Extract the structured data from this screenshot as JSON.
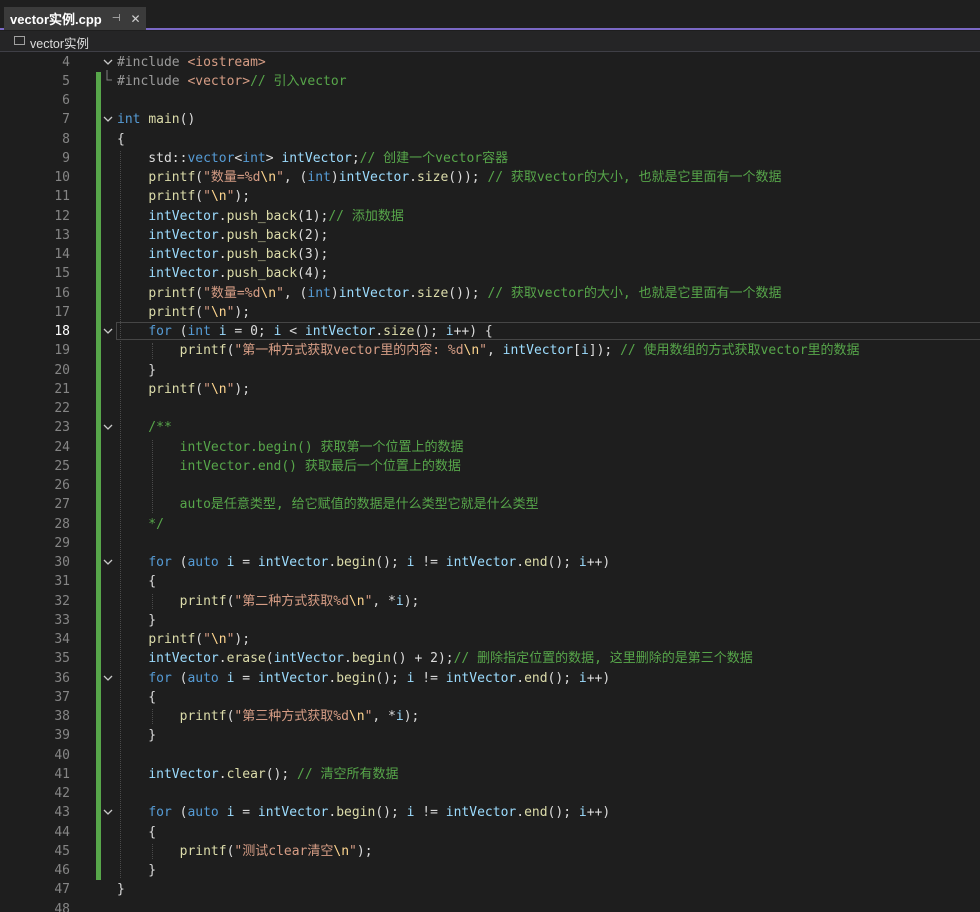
{
  "tab": {
    "title": "vector实例.cpp",
    "pin_glyph": "⊣",
    "close_glyph": "✕"
  },
  "navigation": {
    "file_label": "vector实例"
  },
  "editor": {
    "current_line": 18,
    "lines": [
      {
        "num": "4",
        "fold": "open",
        "tokens": [
          [
            "pp",
            "#include "
          ],
          [
            "str",
            "<iostream>"
          ]
        ]
      },
      {
        "num": "5",
        "fold": "end",
        "tokens": [
          [
            "pp",
            "#include "
          ],
          [
            "str",
            "<vector>"
          ],
          [
            "cm",
            "// 引入vector"
          ]
        ]
      },
      {
        "num": "6",
        "fold": "",
        "tokens": []
      },
      {
        "num": "7",
        "fold": "open",
        "tokens": [
          [
            "kw",
            "int"
          ],
          [
            "plain",
            " "
          ],
          [
            "fn",
            "main"
          ],
          [
            "plain",
            "()"
          ]
        ]
      },
      {
        "num": "8",
        "fold": "",
        "tokens": [
          [
            "plain",
            "{"
          ]
        ]
      },
      {
        "num": "9",
        "fold": "",
        "tokens": [
          [
            "plain",
            "    std::"
          ],
          [
            "kw",
            "vector"
          ],
          [
            "plain",
            "<"
          ],
          [
            "kw",
            "int"
          ],
          [
            "plain",
            "> "
          ],
          [
            "var",
            "intVector"
          ],
          [
            "plain",
            ";"
          ],
          [
            "cm",
            "// 创建一个vector容器"
          ]
        ]
      },
      {
        "num": "10",
        "fold": "",
        "tokens": [
          [
            "plain",
            "    "
          ],
          [
            "fn",
            "printf"
          ],
          [
            "plain",
            "("
          ],
          [
            "str",
            "\"数量=%d"
          ],
          [
            "esc",
            "\\n"
          ],
          [
            "str",
            "\""
          ],
          [
            "plain",
            ", ("
          ],
          [
            "kw",
            "int"
          ],
          [
            "plain",
            ")"
          ],
          [
            "var",
            "intVector"
          ],
          [
            "plain",
            "."
          ],
          [
            "fn",
            "size"
          ],
          [
            "plain",
            "()); "
          ],
          [
            "cm",
            "// 获取vector的大小, 也就是它里面有一个数据"
          ]
        ]
      },
      {
        "num": "11",
        "fold": "",
        "tokens": [
          [
            "plain",
            "    "
          ],
          [
            "fn",
            "printf"
          ],
          [
            "plain",
            "("
          ],
          [
            "str",
            "\""
          ],
          [
            "esc",
            "\\n"
          ],
          [
            "str",
            "\""
          ],
          [
            "plain",
            ");"
          ]
        ]
      },
      {
        "num": "12",
        "fold": "",
        "tokens": [
          [
            "plain",
            "    "
          ],
          [
            "var",
            "intVector"
          ],
          [
            "plain",
            "."
          ],
          [
            "fn",
            "push_back"
          ],
          [
            "plain",
            "(1);"
          ],
          [
            "cm",
            "// 添加数据"
          ]
        ]
      },
      {
        "num": "13",
        "fold": "",
        "tokens": [
          [
            "plain",
            "    "
          ],
          [
            "var",
            "intVector"
          ],
          [
            "plain",
            "."
          ],
          [
            "fn",
            "push_back"
          ],
          [
            "plain",
            "(2);"
          ]
        ]
      },
      {
        "num": "14",
        "fold": "",
        "tokens": [
          [
            "plain",
            "    "
          ],
          [
            "var",
            "intVector"
          ],
          [
            "plain",
            "."
          ],
          [
            "fn",
            "push_back"
          ],
          [
            "plain",
            "(3);"
          ]
        ]
      },
      {
        "num": "15",
        "fold": "",
        "tokens": [
          [
            "plain",
            "    "
          ],
          [
            "var",
            "intVector"
          ],
          [
            "plain",
            "."
          ],
          [
            "fn",
            "push_back"
          ],
          [
            "plain",
            "(4);"
          ]
        ]
      },
      {
        "num": "16",
        "fold": "",
        "tokens": [
          [
            "plain",
            "    "
          ],
          [
            "fn",
            "printf"
          ],
          [
            "plain",
            "("
          ],
          [
            "str",
            "\"数量=%d"
          ],
          [
            "esc",
            "\\n"
          ],
          [
            "str",
            "\""
          ],
          [
            "plain",
            ", ("
          ],
          [
            "kw",
            "int"
          ],
          [
            "plain",
            ")"
          ],
          [
            "var",
            "intVector"
          ],
          [
            "plain",
            "."
          ],
          [
            "fn",
            "size"
          ],
          [
            "plain",
            "()); "
          ],
          [
            "cm",
            "// 获取vector的大小, 也就是它里面有一个数据"
          ]
        ]
      },
      {
        "num": "17",
        "fold": "",
        "tokens": [
          [
            "plain",
            "    "
          ],
          [
            "fn",
            "printf"
          ],
          [
            "plain",
            "("
          ],
          [
            "str",
            "\""
          ],
          [
            "esc",
            "\\n"
          ],
          [
            "str",
            "\""
          ],
          [
            "plain",
            ");"
          ]
        ]
      },
      {
        "num": "18",
        "fold": "open",
        "tokens": [
          [
            "plain",
            "    "
          ],
          [
            "kw",
            "for"
          ],
          [
            "plain",
            " ("
          ],
          [
            "kw",
            "int"
          ],
          [
            "plain",
            " "
          ],
          [
            "var",
            "i"
          ],
          [
            "plain",
            " = 0; "
          ],
          [
            "var",
            "i"
          ],
          [
            "plain",
            " < "
          ],
          [
            "var",
            "intVector"
          ],
          [
            "plain",
            "."
          ],
          [
            "fn",
            "size"
          ],
          [
            "plain",
            "(); "
          ],
          [
            "var",
            "i"
          ],
          [
            "plain",
            "++) {"
          ]
        ]
      },
      {
        "num": "19",
        "fold": "",
        "tokens": [
          [
            "plain",
            "        "
          ],
          [
            "fn",
            "printf"
          ],
          [
            "plain",
            "("
          ],
          [
            "str",
            "\"第一种方式获取vector里的内容: %d"
          ],
          [
            "esc",
            "\\n"
          ],
          [
            "str",
            "\""
          ],
          [
            "plain",
            ", "
          ],
          [
            "var",
            "intVector"
          ],
          [
            "plain",
            "["
          ],
          [
            "var",
            "i"
          ],
          [
            "plain",
            "]); "
          ],
          [
            "cm",
            "// 使用数组的方式获取vector里的数据"
          ]
        ]
      },
      {
        "num": "20",
        "fold": "",
        "tokens": [
          [
            "plain",
            "    }"
          ]
        ]
      },
      {
        "num": "21",
        "fold": "",
        "tokens": [
          [
            "plain",
            "    "
          ],
          [
            "fn",
            "printf"
          ],
          [
            "plain",
            "("
          ],
          [
            "str",
            "\""
          ],
          [
            "esc",
            "\\n"
          ],
          [
            "str",
            "\""
          ],
          [
            "plain",
            ");"
          ]
        ]
      },
      {
        "num": "22",
        "fold": "",
        "tokens": []
      },
      {
        "num": "23",
        "fold": "open",
        "tokens": [
          [
            "cm",
            "    /**"
          ]
        ]
      },
      {
        "num": "24",
        "fold": "",
        "tokens": [
          [
            "cm",
            "        intVector.begin() 获取第一个位置上的数据"
          ]
        ]
      },
      {
        "num": "25",
        "fold": "",
        "tokens": [
          [
            "cm",
            "        intVector.end() 获取最后一个位置上的数据"
          ]
        ]
      },
      {
        "num": "26",
        "fold": "",
        "tokens": []
      },
      {
        "num": "27",
        "fold": "",
        "tokens": [
          [
            "cm",
            "        auto是任意类型, 给它赋值的数据是什么类型它就是什么类型"
          ]
        ]
      },
      {
        "num": "28",
        "fold": "",
        "tokens": [
          [
            "cm",
            "    */"
          ]
        ]
      },
      {
        "num": "29",
        "fold": "",
        "tokens": []
      },
      {
        "num": "30",
        "fold": "open",
        "tokens": [
          [
            "plain",
            "    "
          ],
          [
            "kw",
            "for"
          ],
          [
            "plain",
            " ("
          ],
          [
            "kw",
            "auto"
          ],
          [
            "plain",
            " "
          ],
          [
            "var",
            "i"
          ],
          [
            "plain",
            " = "
          ],
          [
            "var",
            "intVector"
          ],
          [
            "plain",
            "."
          ],
          [
            "fn",
            "begin"
          ],
          [
            "plain",
            "(); "
          ],
          [
            "var",
            "i"
          ],
          [
            "plain",
            " != "
          ],
          [
            "var",
            "intVector"
          ],
          [
            "plain",
            "."
          ],
          [
            "fn",
            "end"
          ],
          [
            "plain",
            "(); "
          ],
          [
            "var",
            "i"
          ],
          [
            "plain",
            "++)"
          ]
        ]
      },
      {
        "num": "31",
        "fold": "",
        "tokens": [
          [
            "plain",
            "    {"
          ]
        ]
      },
      {
        "num": "32",
        "fold": "",
        "tokens": [
          [
            "plain",
            "        "
          ],
          [
            "fn",
            "printf"
          ],
          [
            "plain",
            "("
          ],
          [
            "str",
            "\"第二种方式获取%d"
          ],
          [
            "esc",
            "\\n"
          ],
          [
            "str",
            "\""
          ],
          [
            "plain",
            ", *"
          ],
          [
            "var",
            "i"
          ],
          [
            "plain",
            ");"
          ]
        ]
      },
      {
        "num": "33",
        "fold": "",
        "tokens": [
          [
            "plain",
            "    }"
          ]
        ]
      },
      {
        "num": "34",
        "fold": "",
        "tokens": [
          [
            "plain",
            "    "
          ],
          [
            "fn",
            "printf"
          ],
          [
            "plain",
            "("
          ],
          [
            "str",
            "\""
          ],
          [
            "esc",
            "\\n"
          ],
          [
            "str",
            "\""
          ],
          [
            "plain",
            ");"
          ]
        ]
      },
      {
        "num": "35",
        "fold": "",
        "tokens": [
          [
            "plain",
            "    "
          ],
          [
            "var",
            "intVector"
          ],
          [
            "plain",
            "."
          ],
          [
            "fn",
            "erase"
          ],
          [
            "plain",
            "("
          ],
          [
            "var",
            "intVector"
          ],
          [
            "plain",
            "."
          ],
          [
            "fn",
            "begin"
          ],
          [
            "plain",
            "() + 2);"
          ],
          [
            "cm",
            "// 删除指定位置的数据, 这里删除的是第三个数据"
          ]
        ]
      },
      {
        "num": "36",
        "fold": "open",
        "tokens": [
          [
            "plain",
            "    "
          ],
          [
            "kw",
            "for"
          ],
          [
            "plain",
            " ("
          ],
          [
            "kw",
            "auto"
          ],
          [
            "plain",
            " "
          ],
          [
            "var",
            "i"
          ],
          [
            "plain",
            " = "
          ],
          [
            "var",
            "intVector"
          ],
          [
            "plain",
            "."
          ],
          [
            "fn",
            "begin"
          ],
          [
            "plain",
            "(); "
          ],
          [
            "var",
            "i"
          ],
          [
            "plain",
            " != "
          ],
          [
            "var",
            "intVector"
          ],
          [
            "plain",
            "."
          ],
          [
            "fn",
            "end"
          ],
          [
            "plain",
            "(); "
          ],
          [
            "var",
            "i"
          ],
          [
            "plain",
            "++)"
          ]
        ]
      },
      {
        "num": "37",
        "fold": "",
        "tokens": [
          [
            "plain",
            "    {"
          ]
        ]
      },
      {
        "num": "38",
        "fold": "",
        "tokens": [
          [
            "plain",
            "        "
          ],
          [
            "fn",
            "printf"
          ],
          [
            "plain",
            "("
          ],
          [
            "str",
            "\"第三种方式获取%d"
          ],
          [
            "esc",
            "\\n"
          ],
          [
            "str",
            "\""
          ],
          [
            "plain",
            ", *"
          ],
          [
            "var",
            "i"
          ],
          [
            "plain",
            ");"
          ]
        ]
      },
      {
        "num": "39",
        "fold": "",
        "tokens": [
          [
            "plain",
            "    }"
          ]
        ]
      },
      {
        "num": "40",
        "fold": "",
        "tokens": []
      },
      {
        "num": "41",
        "fold": "",
        "tokens": [
          [
            "plain",
            "    "
          ],
          [
            "var",
            "intVector"
          ],
          [
            "plain",
            "."
          ],
          [
            "fn",
            "clear"
          ],
          [
            "plain",
            "(); "
          ],
          [
            "cm",
            "// 清空所有数据"
          ]
        ]
      },
      {
        "num": "42",
        "fold": "",
        "tokens": []
      },
      {
        "num": "43",
        "fold": "open",
        "tokens": [
          [
            "plain",
            "    "
          ],
          [
            "kw",
            "for"
          ],
          [
            "plain",
            " ("
          ],
          [
            "kw",
            "auto"
          ],
          [
            "plain",
            " "
          ],
          [
            "var",
            "i"
          ],
          [
            "plain",
            " = "
          ],
          [
            "var",
            "intVector"
          ],
          [
            "plain",
            "."
          ],
          [
            "fn",
            "begin"
          ],
          [
            "plain",
            "(); "
          ],
          [
            "var",
            "i"
          ],
          [
            "plain",
            " != "
          ],
          [
            "var",
            "intVector"
          ],
          [
            "plain",
            "."
          ],
          [
            "fn",
            "end"
          ],
          [
            "plain",
            "(); "
          ],
          [
            "var",
            "i"
          ],
          [
            "plain",
            "++)"
          ]
        ]
      },
      {
        "num": "44",
        "fold": "",
        "tokens": [
          [
            "plain",
            "    {"
          ]
        ]
      },
      {
        "num": "45",
        "fold": "",
        "tokens": [
          [
            "plain",
            "        "
          ],
          [
            "fn",
            "printf"
          ],
          [
            "plain",
            "("
          ],
          [
            "str",
            "\"测试clear清空"
          ],
          [
            "esc",
            "\\n"
          ],
          [
            "str",
            "\""
          ],
          [
            "plain",
            ");"
          ]
        ]
      },
      {
        "num": "46",
        "fold": "",
        "tokens": [
          [
            "plain",
            "    }"
          ]
        ]
      },
      {
        "num": "47",
        "fold": "",
        "tokens": [
          [
            "plain",
            "}"
          ]
        ]
      },
      {
        "num": "48",
        "fold": "",
        "tokens": []
      }
    ]
  },
  "colors": {
    "accent": "#7a68c5",
    "change_bar": "#57a64a",
    "keyword": "#569cd6",
    "function": "#dcdcaa",
    "variable": "#9cdcfe",
    "string": "#d69d85",
    "comment": "#57a64a",
    "escape": "#ffd68f",
    "preprocessor": "#9b9b9b"
  }
}
